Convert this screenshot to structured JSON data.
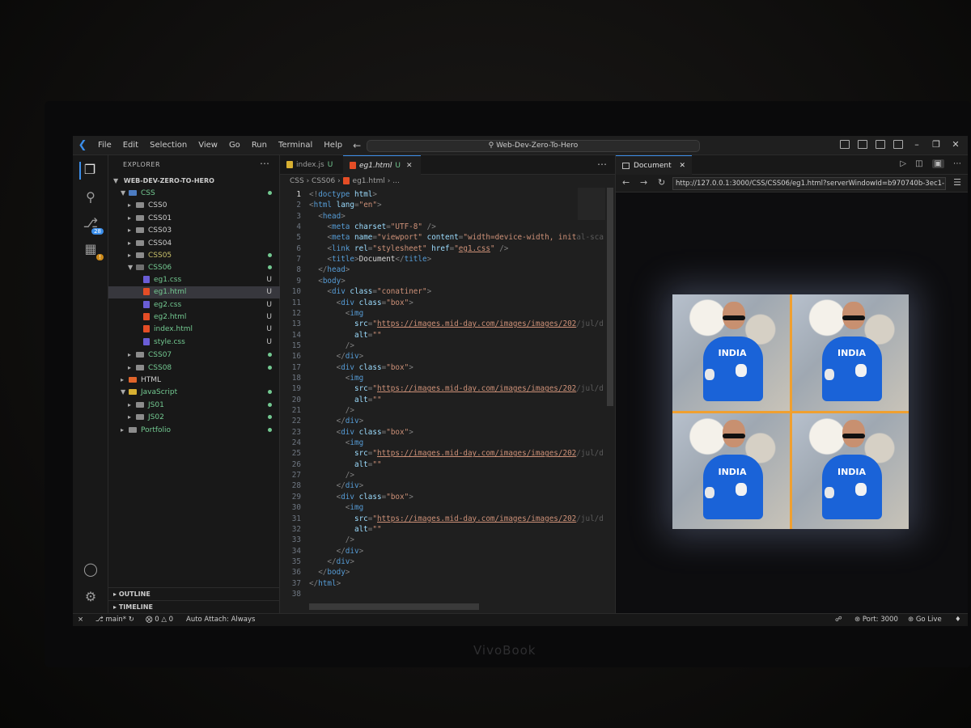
{
  "menu": [
    "File",
    "Edit",
    "Selection",
    "View",
    "Go",
    "Run",
    "Terminal",
    "Help"
  ],
  "command_center": "Web-Dev-Zero-To-Hero",
  "activity": {
    "scm_badge": "28"
  },
  "explorer": {
    "title": "EXPLORER",
    "root": "WEB-DEV-ZERO-TO-HERO",
    "items": [
      {
        "label": "CSS",
        "kind": "folder-css",
        "open": true,
        "indent": 1,
        "status": "dot",
        "color": "green"
      },
      {
        "label": "CSS0",
        "kind": "folder",
        "open": false,
        "indent": 2,
        "status": "",
        "color": "white"
      },
      {
        "label": "CSS01",
        "kind": "folder",
        "open": false,
        "indent": 2,
        "status": "",
        "color": "white"
      },
      {
        "label": "CSS03",
        "kind": "folder",
        "open": false,
        "indent": 2,
        "status": "",
        "color": "white"
      },
      {
        "label": "CSS04",
        "kind": "folder",
        "open": false,
        "indent": 2,
        "status": "",
        "color": "white"
      },
      {
        "label": "CSS05",
        "kind": "folder",
        "open": false,
        "indent": 2,
        "status": "dot",
        "color": "yellow"
      },
      {
        "label": "CSS06",
        "kind": "folder",
        "open": true,
        "indent": 2,
        "status": "dot",
        "color": "green"
      },
      {
        "label": "eg1.css",
        "kind": "css",
        "open": false,
        "indent": 3,
        "status": "U",
        "color": "green"
      },
      {
        "label": "eg1.html",
        "kind": "html",
        "open": false,
        "indent": 3,
        "status": "U",
        "color": "green",
        "selected": true
      },
      {
        "label": "eg2.css",
        "kind": "css",
        "open": false,
        "indent": 3,
        "status": "U",
        "color": "green"
      },
      {
        "label": "eg2.html",
        "kind": "html",
        "open": false,
        "indent": 3,
        "status": "U",
        "color": "green"
      },
      {
        "label": "index.html",
        "kind": "html",
        "open": false,
        "indent": 3,
        "status": "U",
        "color": "green"
      },
      {
        "label": "style.css",
        "kind": "css",
        "open": false,
        "indent": 3,
        "status": "U",
        "color": "green"
      },
      {
        "label": "CSS07",
        "kind": "folder",
        "open": false,
        "indent": 2,
        "status": "dot",
        "color": "green"
      },
      {
        "label": "CSS08",
        "kind": "folder",
        "open": false,
        "indent": 2,
        "status": "dot",
        "color": "green"
      },
      {
        "label": "HTML",
        "kind": "folder-html",
        "open": false,
        "indent": 1,
        "status": "",
        "color": "white"
      },
      {
        "label": "JavaScript",
        "kind": "folder-js",
        "open": true,
        "indent": 1,
        "status": "dot",
        "color": "green"
      },
      {
        "label": "JS01",
        "kind": "folder",
        "open": false,
        "indent": 2,
        "status": "dot",
        "color": "green"
      },
      {
        "label": "JS02",
        "kind": "folder",
        "open": false,
        "indent": 2,
        "status": "dot",
        "color": "green"
      },
      {
        "label": "Portfolio",
        "kind": "folder",
        "open": false,
        "indent": 1,
        "status": "dot",
        "color": "green"
      }
    ],
    "sections": [
      "OUTLINE",
      "TIMELINE"
    ]
  },
  "editor": {
    "tabs": [
      {
        "label": "index.js",
        "status": "U",
        "icon": "js",
        "active": false
      },
      {
        "label": "eg1.html",
        "status": "U",
        "icon": "html",
        "active": true
      }
    ],
    "breadcrumb": [
      "CSS",
      "CSS06",
      "eg1.html",
      "..."
    ],
    "current_line": 1,
    "lines": [
      [
        [
          "pun",
          "<!"
        ],
        [
          "tag",
          "doctype"
        ],
        [
          "txt",
          " "
        ],
        [
          "attr",
          "html"
        ],
        [
          "pun",
          ">"
        ]
      ],
      [
        [
          "pun",
          "<"
        ],
        [
          "tag",
          "html"
        ],
        [
          "txt",
          " "
        ],
        [
          "attr",
          "lang"
        ],
        [
          "pun",
          "="
        ],
        [
          "val",
          "\"en\""
        ],
        [
          "pun",
          ">"
        ]
      ],
      [
        [
          "txt",
          "  "
        ],
        [
          "pun",
          "<"
        ],
        [
          "tag",
          "head"
        ],
        [
          "pun",
          ">"
        ]
      ],
      [
        [
          "txt",
          "    "
        ],
        [
          "pun",
          "<"
        ],
        [
          "tag",
          "meta"
        ],
        [
          "txt",
          " "
        ],
        [
          "attr",
          "charset"
        ],
        [
          "pun",
          "="
        ],
        [
          "val",
          "\"UTF-8\""
        ],
        [
          "txt",
          " "
        ],
        [
          "pun",
          "/>"
        ]
      ],
      [
        [
          "txt",
          "    "
        ],
        [
          "pun",
          "<"
        ],
        [
          "tag",
          "meta"
        ],
        [
          "txt",
          " "
        ],
        [
          "attr",
          "name"
        ],
        [
          "pun",
          "="
        ],
        [
          "val",
          "\"viewport\""
        ],
        [
          "txt",
          " "
        ],
        [
          "attr",
          "content"
        ],
        [
          "pun",
          "="
        ],
        [
          "val",
          "\"width=device-width, init"
        ],
        [
          "ghost",
          "al-sca"
        ]
      ],
      [
        [
          "txt",
          "    "
        ],
        [
          "pun",
          "<"
        ],
        [
          "tag",
          "link"
        ],
        [
          "txt",
          " "
        ],
        [
          "attr",
          "rel"
        ],
        [
          "pun",
          "="
        ],
        [
          "val",
          "\"stylesheet\""
        ],
        [
          "txt",
          " "
        ],
        [
          "attr",
          "href"
        ],
        [
          "pun",
          "="
        ],
        [
          "val",
          "\""
        ],
        [
          "url",
          "eg1.css"
        ],
        [
          "val",
          "\""
        ],
        [
          "txt",
          " "
        ],
        [
          "pun",
          "/>"
        ]
      ],
      [
        [
          "txt",
          "    "
        ],
        [
          "pun",
          "<"
        ],
        [
          "tag",
          "title"
        ],
        [
          "pun",
          ">"
        ],
        [
          "txt",
          "Document"
        ],
        [
          "pun",
          "</"
        ],
        [
          "tag",
          "title"
        ],
        [
          "pun",
          ">"
        ]
      ],
      [
        [
          "txt",
          "  "
        ],
        [
          "pun",
          "</"
        ],
        [
          "tag",
          "head"
        ],
        [
          "pun",
          ">"
        ]
      ],
      [
        [
          "txt",
          "  "
        ],
        [
          "pun",
          "<"
        ],
        [
          "tag",
          "body"
        ],
        [
          "pun",
          ">"
        ]
      ],
      [
        [
          "txt",
          "    "
        ],
        [
          "pun",
          "<"
        ],
        [
          "tag",
          "div"
        ],
        [
          "txt",
          " "
        ],
        [
          "attr",
          "class"
        ],
        [
          "pun",
          "="
        ],
        [
          "val",
          "\"conatiner\""
        ],
        [
          "pun",
          ">"
        ]
      ],
      [
        [
          "txt",
          "      "
        ],
        [
          "pun",
          "<"
        ],
        [
          "tag",
          "div"
        ],
        [
          "txt",
          " "
        ],
        [
          "attr",
          "class"
        ],
        [
          "pun",
          "="
        ],
        [
          "val",
          "\"box\""
        ],
        [
          "pun",
          ">"
        ]
      ],
      [
        [
          "txt",
          "        "
        ],
        [
          "pun",
          "<"
        ],
        [
          "tag",
          "img"
        ]
      ],
      [
        [
          "txt",
          "          "
        ],
        [
          "attr",
          "src"
        ],
        [
          "pun",
          "="
        ],
        [
          "val",
          "\""
        ],
        [
          "url",
          "https://images.mid-day.com/images/images/202"
        ],
        [
          "ghost",
          "/jul/dh"
        ]
      ],
      [
        [
          "txt",
          "          "
        ],
        [
          "attr",
          "alt"
        ],
        [
          "pun",
          "="
        ],
        [
          "val",
          "\"\""
        ]
      ],
      [
        [
          "txt",
          "        "
        ],
        [
          "pun",
          "/>"
        ]
      ],
      [
        [
          "txt",
          "      "
        ],
        [
          "pun",
          "</"
        ],
        [
          "tag",
          "div"
        ],
        [
          "pun",
          ">"
        ]
      ],
      [
        [
          "txt",
          "      "
        ],
        [
          "pun",
          "<"
        ],
        [
          "tag",
          "div"
        ],
        [
          "txt",
          " "
        ],
        [
          "attr",
          "class"
        ],
        [
          "pun",
          "="
        ],
        [
          "val",
          "\"box\""
        ],
        [
          "pun",
          ">"
        ]
      ],
      [
        [
          "txt",
          "        "
        ],
        [
          "pun",
          "<"
        ],
        [
          "tag",
          "img"
        ]
      ],
      [
        [
          "txt",
          "          "
        ],
        [
          "attr",
          "src"
        ],
        [
          "pun",
          "="
        ],
        [
          "val",
          "\""
        ],
        [
          "url",
          "https://images.mid-day.com/images/images/202"
        ],
        [
          "ghost",
          "/jul/dh"
        ]
      ],
      [
        [
          "txt",
          "          "
        ],
        [
          "attr",
          "alt"
        ],
        [
          "pun",
          "="
        ],
        [
          "val",
          "\"\""
        ]
      ],
      [
        [
          "txt",
          "        "
        ],
        [
          "pun",
          "/>"
        ]
      ],
      [
        [
          "txt",
          "      "
        ],
        [
          "pun",
          "</"
        ],
        [
          "tag",
          "div"
        ],
        [
          "pun",
          ">"
        ]
      ],
      [
        [
          "txt",
          "      "
        ],
        [
          "pun",
          "<"
        ],
        [
          "tag",
          "div"
        ],
        [
          "txt",
          " "
        ],
        [
          "attr",
          "class"
        ],
        [
          "pun",
          "="
        ],
        [
          "val",
          "\"box\""
        ],
        [
          "pun",
          ">"
        ]
      ],
      [
        [
          "txt",
          "        "
        ],
        [
          "pun",
          "<"
        ],
        [
          "tag",
          "img"
        ]
      ],
      [
        [
          "txt",
          "          "
        ],
        [
          "attr",
          "src"
        ],
        [
          "pun",
          "="
        ],
        [
          "val",
          "\""
        ],
        [
          "url",
          "https://images.mid-day.com/images/images/202"
        ],
        [
          "ghost",
          "/jul/dh"
        ]
      ],
      [
        [
          "txt",
          "          "
        ],
        [
          "attr",
          "alt"
        ],
        [
          "pun",
          "="
        ],
        [
          "val",
          "\"\""
        ]
      ],
      [
        [
          "txt",
          "        "
        ],
        [
          "pun",
          "/>"
        ]
      ],
      [
        [
          "txt",
          "      "
        ],
        [
          "pun",
          "</"
        ],
        [
          "tag",
          "div"
        ],
        [
          "pun",
          ">"
        ]
      ],
      [
        [
          "txt",
          "      "
        ],
        [
          "pun",
          "<"
        ],
        [
          "tag",
          "div"
        ],
        [
          "txt",
          " "
        ],
        [
          "attr",
          "class"
        ],
        [
          "pun",
          "="
        ],
        [
          "val",
          "\"box\""
        ],
        [
          "pun",
          ">"
        ]
      ],
      [
        [
          "txt",
          "        "
        ],
        [
          "pun",
          "<"
        ],
        [
          "tag",
          "img"
        ]
      ],
      [
        [
          "txt",
          "          "
        ],
        [
          "attr",
          "src"
        ],
        [
          "pun",
          "="
        ],
        [
          "val",
          "\""
        ],
        [
          "url",
          "https://images.mid-day.com/images/images/202"
        ],
        [
          "ghost",
          "/jul/dh"
        ]
      ],
      [
        [
          "txt",
          "          "
        ],
        [
          "attr",
          "alt"
        ],
        [
          "pun",
          "="
        ],
        [
          "val",
          "\"\""
        ]
      ],
      [
        [
          "txt",
          "        "
        ],
        [
          "pun",
          "/>"
        ]
      ],
      [
        [
          "txt",
          "      "
        ],
        [
          "pun",
          "</"
        ],
        [
          "tag",
          "div"
        ],
        [
          "pun",
          ">"
        ]
      ],
      [
        [
          "txt",
          "    "
        ],
        [
          "pun",
          "</"
        ],
        [
          "tag",
          "div"
        ],
        [
          "pun",
          ">"
        ]
      ],
      [
        [
          "txt",
          "  "
        ],
        [
          "pun",
          "</"
        ],
        [
          "tag",
          "body"
        ],
        [
          "pun",
          ">"
        ]
      ],
      [
        [
          "pun",
          "</"
        ],
        [
          "tag",
          "html"
        ],
        [
          "pun",
          ">"
        ]
      ],
      []
    ]
  },
  "preview": {
    "tab_label": "Document",
    "url": "http://127.0.0.1:3000/CSS/CSS06/eg1.html?serverWindowId=b970740b-3ec1-",
    "image_text": "INDIA",
    "image_count": 4
  },
  "statusbar": {
    "branch": "main*",
    "errors": "0",
    "warnings": "0",
    "auto_attach": "Auto Attach: Always",
    "port": "Port: 3000",
    "go_live": "Go Live"
  },
  "device": {
    "brand": "VivoBook"
  },
  "colors": {
    "accent": "#3b8eea",
    "git_untracked": "#73c991",
    "preview_border": "#f0a030"
  }
}
